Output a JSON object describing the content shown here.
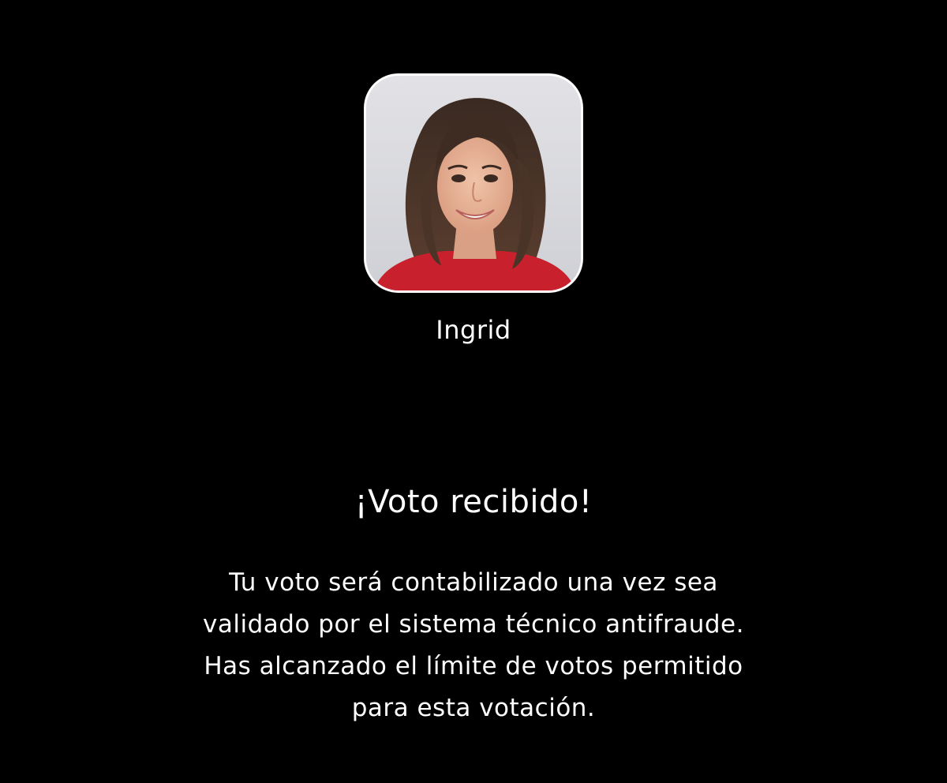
{
  "contestant": {
    "name": "Ingrid",
    "photo_icon": "contestant-photo"
  },
  "confirmation": {
    "title": "¡Voto recibido!",
    "message_lines": [
      "Tu voto será contabilizado una vez sea",
      "validado por el sistema técnico antifraude.",
      "Has alcanzado el límite de votos permitido",
      "para esta votación."
    ]
  },
  "colors": {
    "background": "#000000",
    "text": "#ffffff",
    "photo_background": "#d9d9de",
    "shirt": "#c8202c"
  }
}
